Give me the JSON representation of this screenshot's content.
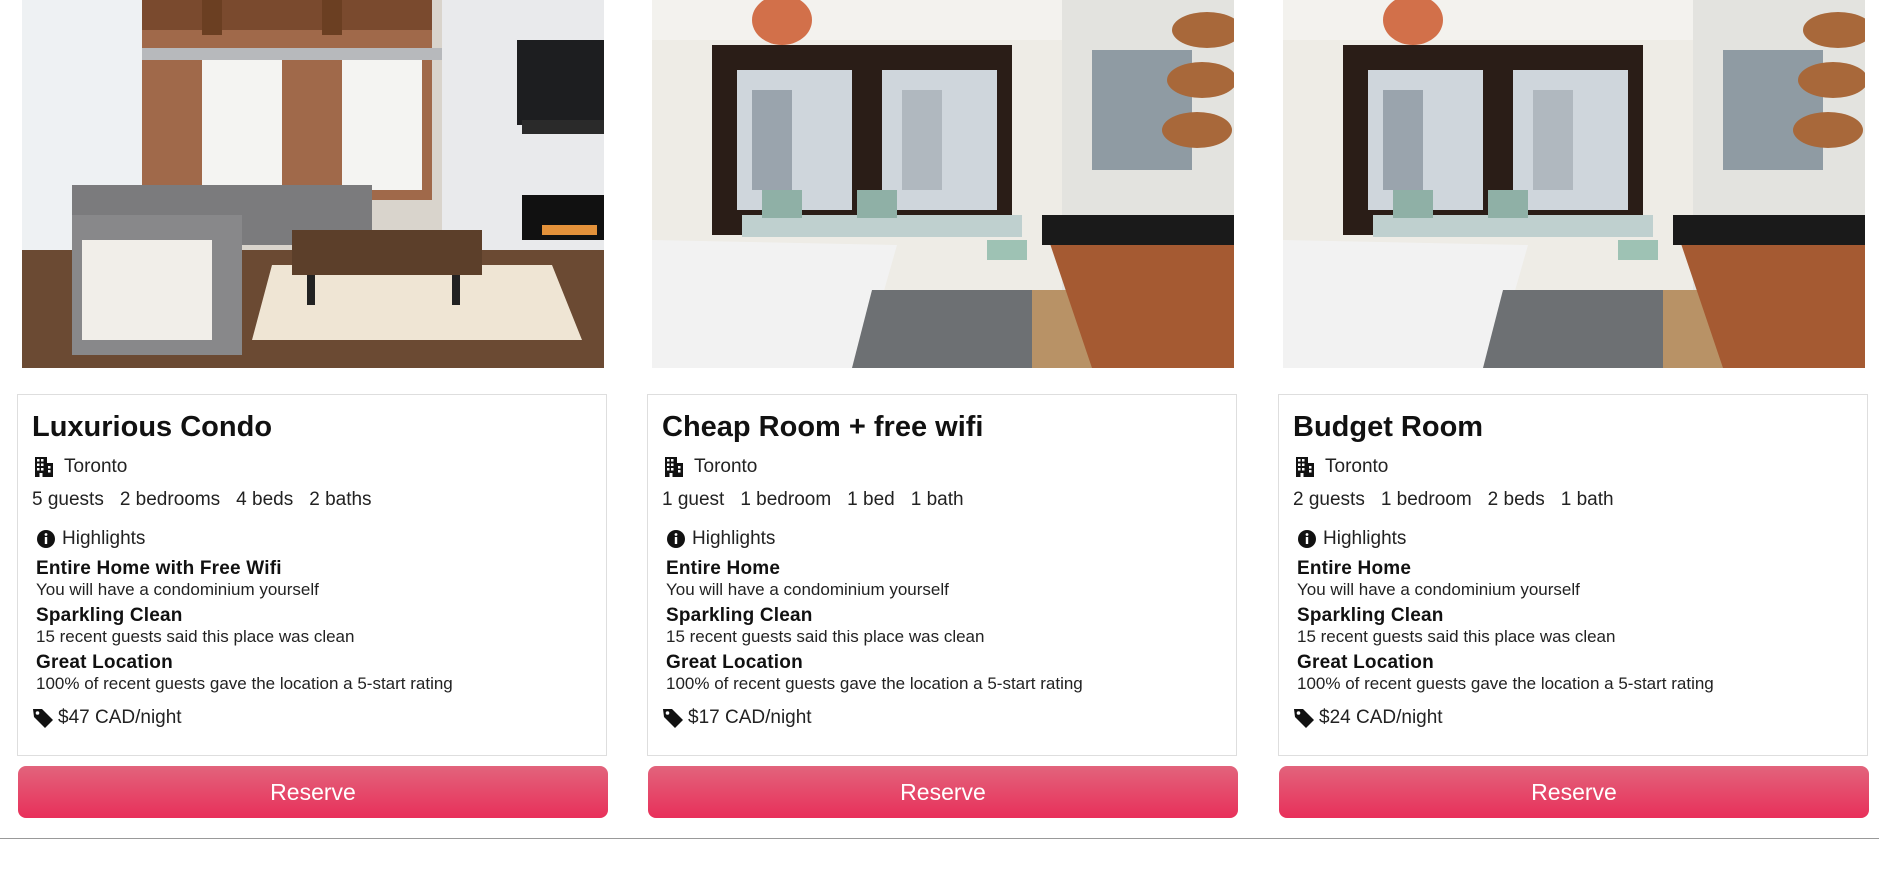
{
  "listings": [
    {
      "title": "Luxurious Condo",
      "location": "Toronto",
      "stats": [
        "5 guests",
        "2 bedrooms",
        "4 beds",
        "2 baths"
      ],
      "highlights_label": "Highlights",
      "highlights": [
        {
          "title": "Entire Home with Free Wifi",
          "desc": "You will have a condominium yourself"
        },
        {
          "title": "Sparkling Clean",
          "desc": "15 recent guests said this place was clean"
        },
        {
          "title": "Great Location",
          "desc": "100% of recent guests gave the location a 5-start rating"
        }
      ],
      "price": "$47 CAD/night",
      "reserve_label": "Reserve"
    },
    {
      "title": "Cheap Room + free wifi",
      "location": "Toronto",
      "stats": [
        "1 guest",
        "1 bedroom",
        "1 bed",
        "1 bath"
      ],
      "highlights_label": "Highlights",
      "highlights": [
        {
          "title": "Entire Home",
          "desc": "You will have a condominium yourself"
        },
        {
          "title": "Sparkling Clean",
          "desc": "15 recent guests said this place was clean"
        },
        {
          "title": "Great Location",
          "desc": "100% of recent guests gave the location a 5-start rating"
        }
      ],
      "price": "$17 CAD/night",
      "reserve_label": "Reserve"
    },
    {
      "title": "Budget Room",
      "location": "Toronto",
      "stats": [
        "2 guests",
        "1 bedroom",
        "2 beds",
        "1 bath"
      ],
      "highlights_label": "Highlights",
      "highlights": [
        {
          "title": "Entire Home",
          "desc": "You will have a condominium yourself"
        },
        {
          "title": "Sparkling Clean",
          "desc": "15 recent guests said this place was clean"
        },
        {
          "title": "Great Location",
          "desc": "100% of recent guests gave the location a 5-start rating"
        }
      ],
      "price": "$24 CAD/night",
      "reserve_label": "Reserve"
    }
  ],
  "colors": {
    "reserve_top": "#e2647c",
    "reserve_bottom": "#e8305a"
  },
  "icons": {
    "location": "building-icon",
    "highlights": "info-circle-icon",
    "price": "tag-icon"
  }
}
